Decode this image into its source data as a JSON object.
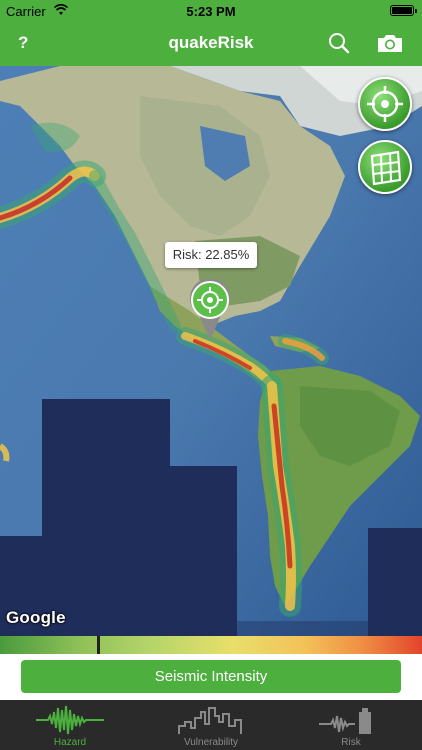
{
  "status_bar": {
    "carrier": "Carrier",
    "time": "5:23 PM"
  },
  "nav": {
    "help": "?",
    "title": "quakeRisk",
    "search_icon": "search-icon",
    "camera_icon": "camera-icon"
  },
  "map": {
    "callout_text": "Risk: 22.85%",
    "google_label": "Google",
    "locate_button_icon": "crosshair-icon",
    "grid_button_icon": "grid-globe-icon"
  },
  "scale": {
    "colors": [
      "#4a9b3e",
      "#8cbf56",
      "#b3d46a",
      "#e8df6a",
      "#f3c259",
      "#ef8e44",
      "#e2442c"
    ],
    "marker_fraction": 0.23
  },
  "intensity_button": {
    "label": "Seismic Intensity"
  },
  "tabs": [
    {
      "label": "Hazard",
      "icon": "seismograph-icon",
      "active": true,
      "color": "#4caf3e"
    },
    {
      "label": "Vulnerability",
      "icon": "city-skyline-icon",
      "active": false,
      "color": "#8a8a8a"
    },
    {
      "label": "Risk",
      "icon": "seismo-building-icon",
      "active": false,
      "color": "#8a8a8a"
    }
  ],
  "colors": {
    "accent": "#4caf3e",
    "tabbar": "#2a2a2a"
  }
}
